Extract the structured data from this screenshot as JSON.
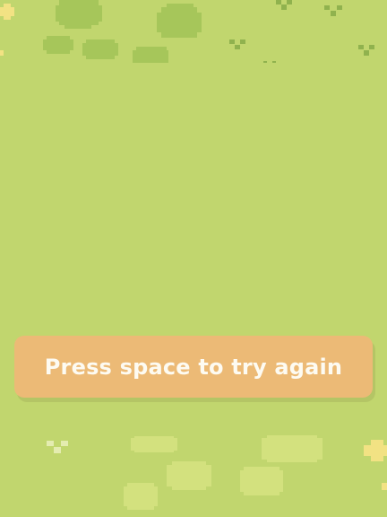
{
  "game": {
    "prompt": "Press space to try again",
    "palette": {
      "grass": "#c1d66e",
      "bush_dark": "#a6c65a",
      "grass_tuft": "#90b24e",
      "grass_light": "#d3e17e",
      "flower": "#f2e283",
      "banner": "#ecba76",
      "banner_text": "#fdfbf2"
    },
    "decor": {
      "bushes": "bush-icon",
      "tufts": "grass-tuft-icon",
      "flowers": "flower-icon",
      "light_patches": "light-grass-patch"
    }
  }
}
